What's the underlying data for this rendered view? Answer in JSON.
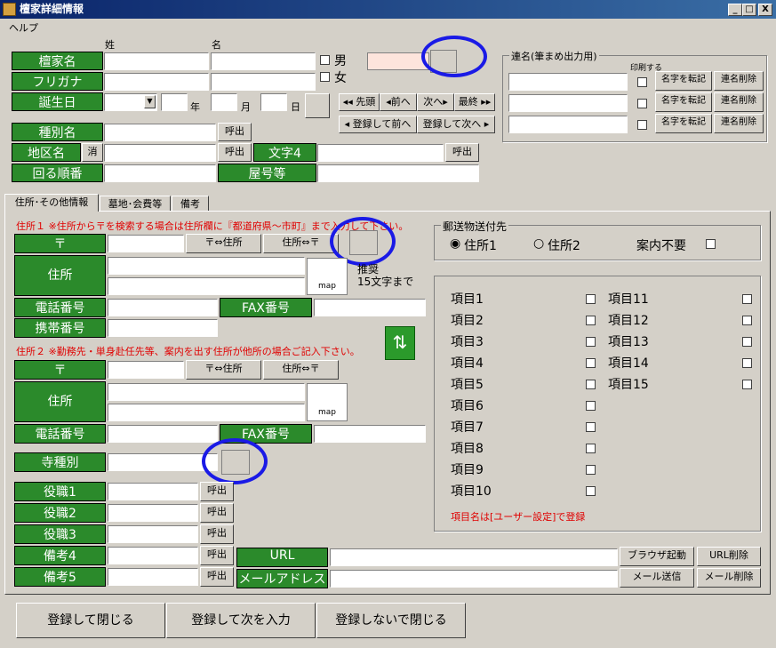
{
  "window": {
    "title": "檀家詳細情報",
    "menu_help": "ヘルプ",
    "min": "_",
    "max": "□",
    "close": "X"
  },
  "header": {
    "sei": "姓",
    "mei": "名"
  },
  "labels": {
    "danka": "檀家名",
    "furigana": "フリガナ",
    "birthday": "誕生日",
    "shubetsu": "種別名",
    "chiku": "地区名",
    "junban": "回る順番",
    "moji4": "文字4",
    "yago": "屋号等"
  },
  "gender": {
    "male": "男",
    "female": "女"
  },
  "date": {
    "year": "年",
    "month": "月",
    "day": "日"
  },
  "buttons": {
    "yobidashi": "呼出",
    "kesu": "消",
    "first": "◂◂ 先頭",
    "prev": "◂前へ",
    "next": "次へ▸",
    "last": "最終 ▸▸",
    "save_prev": "◂ 登録して前へ",
    "save_next": "登録して次へ ▸",
    "copy_name": "名字を転記",
    "del_name": "連名削除",
    "browser": "ブラウザ起動",
    "url_del": "URL削除",
    "mail_send": "メール送信",
    "mail_del": "メール削除",
    "zip_addr": "〒⇔住所",
    "addr_zip": "住所⇔〒",
    "map": "map"
  },
  "renmei": {
    "title": "連名(筆まめ出力用)",
    "print": "印刷する"
  },
  "tabs": [
    "住所･その他情報",
    "墓地･会費等",
    "備考"
  ],
  "addr1": {
    "note": "住所１ ※住所から〒を検索する場合は住所欄に『都道府県～市町』まで入力して下さい。",
    "zip": "〒",
    "addr": "住所",
    "tel": "電話番号",
    "fax": "FAX番号",
    "mobile": "携帯番号",
    "recommend": "推奨\n15文字まで"
  },
  "addr2": {
    "note": "住所２ ※勤務先・単身赴任先等、案内を出す住所が他所の場合ご記入下さい。",
    "zip": "〒",
    "addr": "住所",
    "tel": "電話番号",
    "fax": "FAX番号"
  },
  "tera": {
    "label": "寺種別"
  },
  "yakushoku": [
    "役職1",
    "役職2",
    "役職3",
    "備考4",
    "備考5"
  ],
  "url": {
    "label": "URL",
    "mail": "メールアドレス"
  },
  "mailto": {
    "title": "郵送物送付先",
    "opt1": "住所1",
    "opt2": "住所2",
    "none": "案内不要"
  },
  "items": {
    "left": [
      "項目1",
      "項目2",
      "項目3",
      "項目4",
      "項目5",
      "項目6",
      "項目7",
      "項目8",
      "項目9",
      "項目10"
    ],
    "right": [
      "項目11",
      "項目12",
      "項目13",
      "項目14",
      "項目15"
    ],
    "note": "項目名は[ユーザー設定]で登録"
  },
  "bottom": {
    "save_close": "登録して閉じる",
    "save_next": "登録して次を入力",
    "close_nosave": "登録しないで閉じる"
  }
}
